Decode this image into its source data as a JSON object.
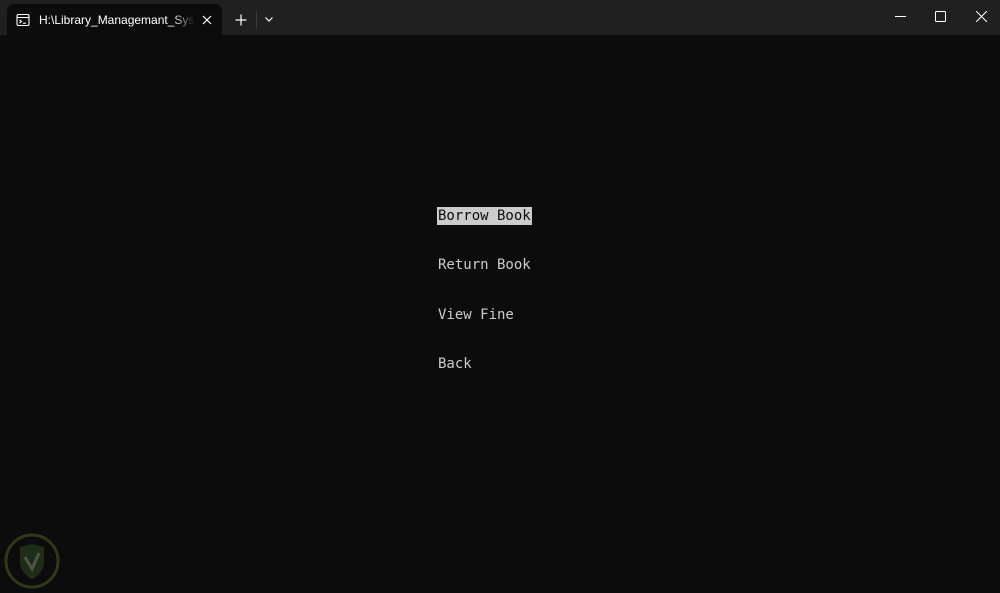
{
  "window": {
    "tab_title": "H:\\Library_Managemant_System",
    "icons": {
      "tab": "terminal-icon",
      "close_tab": "close-icon",
      "new_tab": "plus-icon",
      "dropdown": "chevron-down-icon",
      "minimize": "minimize-icon",
      "maximize": "maximize-icon",
      "close_window": "close-icon"
    }
  },
  "menu": {
    "items": [
      {
        "label": "Borrow Book",
        "selected": true
      },
      {
        "label": "Return Book",
        "selected": false
      },
      {
        "label": "View Fine",
        "selected": false
      },
      {
        "label": "Back",
        "selected": false
      }
    ]
  },
  "colors": {
    "background": "#0c0c0c",
    "titlebar": "#202020",
    "foreground": "#cccccc",
    "selection_bg": "#cccccc",
    "selection_fg": "#0c0c0c"
  }
}
